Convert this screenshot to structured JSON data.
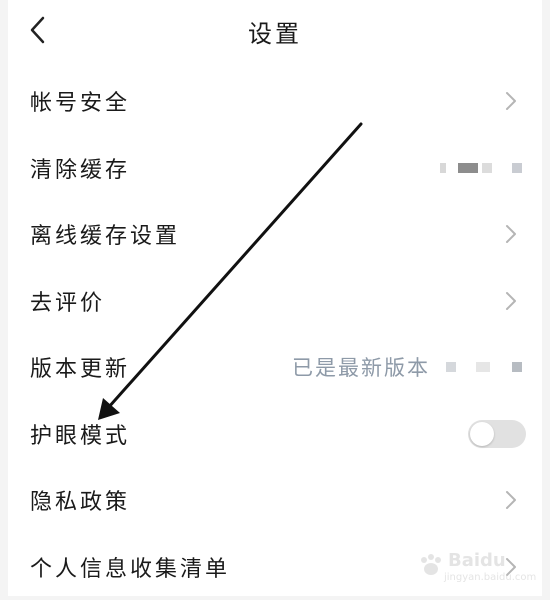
{
  "header": {
    "title": "设置",
    "back_icon": "chevron-left-icon"
  },
  "settings": {
    "items": [
      {
        "label": "帐号安全",
        "trailing": "chevron"
      },
      {
        "label": "清除缓存",
        "trailing": "value"
      },
      {
        "label": "离线缓存设置",
        "trailing": "chevron"
      },
      {
        "label": "去评价",
        "trailing": "chevron"
      },
      {
        "label": "版本更新",
        "trailing": "value",
        "value": "已是最新版本"
      },
      {
        "label": "护眼模式",
        "trailing": "toggle",
        "toggle_on": false
      },
      {
        "label": "隐私政策",
        "trailing": "chevron"
      },
      {
        "label": "个人信息收集清单",
        "trailing": "chevron"
      }
    ]
  },
  "watermark": {
    "text": "Baidu",
    "sub": "jingyan.baidu.com"
  },
  "colors": {
    "background": "#ffffff",
    "text": "#1a1a1a",
    "secondary_text": "#8e9aa8",
    "chevron": "#b5b5b5",
    "toggle_off": "#e1e1e1",
    "annotation": "#111111"
  }
}
